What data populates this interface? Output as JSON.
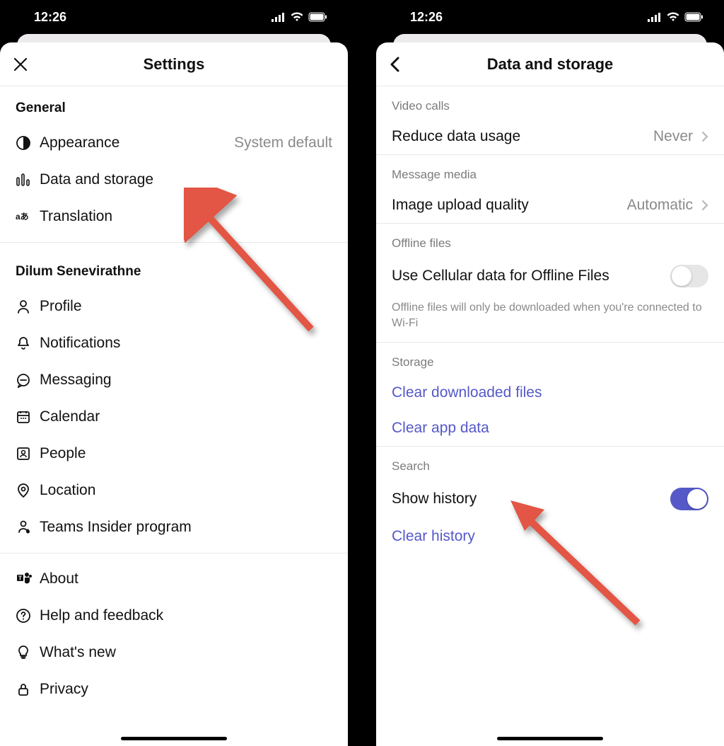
{
  "status": {
    "time": "12:26"
  },
  "left": {
    "title": "Settings",
    "sections": [
      {
        "header": "General",
        "items": [
          {
            "icon": "contrast-icon",
            "label": "Appearance",
            "value": "System default"
          },
          {
            "icon": "bars-icon",
            "label": "Data and storage"
          },
          {
            "icon": "translate-icon",
            "label": "Translation"
          }
        ]
      },
      {
        "header": "Dilum Senevirathne",
        "items": [
          {
            "icon": "profile-icon",
            "label": "Profile"
          },
          {
            "icon": "bell-icon",
            "label": "Notifications"
          },
          {
            "icon": "chat-icon",
            "label": "Messaging"
          },
          {
            "icon": "calendar-icon",
            "label": "Calendar"
          },
          {
            "icon": "people-icon",
            "label": "People"
          },
          {
            "icon": "location-icon",
            "label": "Location"
          },
          {
            "icon": "insider-icon",
            "label": "Teams Insider program"
          }
        ]
      },
      {
        "items": [
          {
            "icon": "teams-icon",
            "label": "About"
          },
          {
            "icon": "help-icon",
            "label": "Help and feedback"
          },
          {
            "icon": "bulb-icon",
            "label": "What's new"
          },
          {
            "icon": "lock-icon",
            "label": "Privacy"
          }
        ]
      }
    ]
  },
  "right": {
    "title": "Data and storage",
    "groups": {
      "video": {
        "label": "Video calls",
        "item_label": "Reduce data usage",
        "item_value": "Never"
      },
      "message": {
        "label": "Message media",
        "item_label": "Image upload quality",
        "item_value": "Automatic"
      },
      "offline": {
        "label": "Offline files",
        "item_label": "Use Cellular data for Offline Files",
        "desc": "Offline files will only be downloaded when you're connected to Wi-Fi"
      },
      "storage": {
        "label": "Storage",
        "link1": "Clear downloaded files",
        "link2": "Clear app data"
      },
      "search": {
        "label": "Search",
        "show_label": "Show history",
        "clear_label": "Clear history"
      }
    }
  }
}
